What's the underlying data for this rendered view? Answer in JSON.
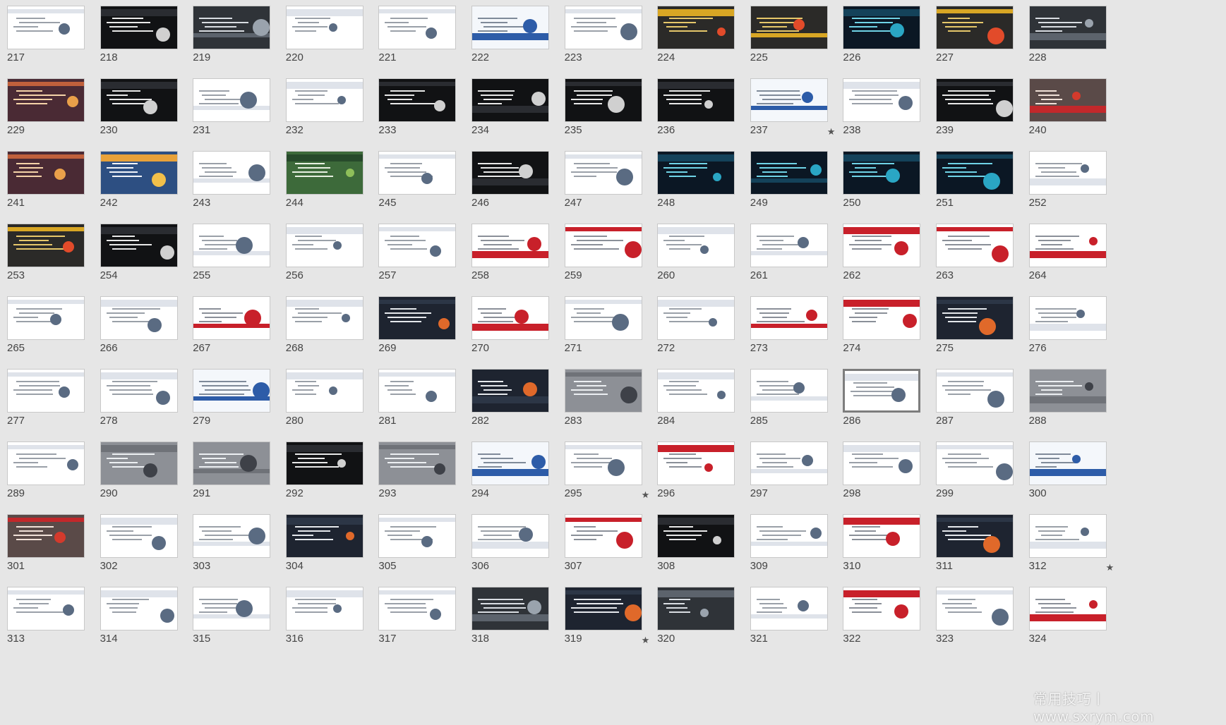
{
  "slides": [
    {
      "number": "217",
      "theme": "light"
    },
    {
      "number": "218",
      "theme": "dark"
    },
    {
      "number": "219",
      "theme": "photo-dark"
    },
    {
      "number": "220",
      "theme": "light"
    },
    {
      "number": "221",
      "theme": "light"
    },
    {
      "number": "222",
      "theme": "light-blue"
    },
    {
      "number": "223",
      "theme": "light"
    },
    {
      "number": "224",
      "theme": "dark-gold"
    },
    {
      "number": "225",
      "theme": "dark-gold"
    },
    {
      "number": "226",
      "theme": "dark-teal"
    },
    {
      "number": "227",
      "theme": "dark-gold"
    },
    {
      "number": "228",
      "theme": "photo-dark"
    },
    {
      "number": "229",
      "theme": "photo-warm"
    },
    {
      "number": "230",
      "theme": "dark"
    },
    {
      "number": "231",
      "theme": "light"
    },
    {
      "number": "232",
      "theme": "light"
    },
    {
      "number": "233",
      "theme": "dark"
    },
    {
      "number": "234",
      "theme": "dark"
    },
    {
      "number": "235",
      "theme": "dark"
    },
    {
      "number": "236",
      "theme": "dark"
    },
    {
      "number": "237",
      "theme": "light-blue",
      "starred": true
    },
    {
      "number": "238",
      "theme": "light"
    },
    {
      "number": "239",
      "theme": "dark"
    },
    {
      "number": "240",
      "theme": "photo-red"
    },
    {
      "number": "241",
      "theme": "photo-warm"
    },
    {
      "number": "242",
      "theme": "photo-blue"
    },
    {
      "number": "243",
      "theme": "light"
    },
    {
      "number": "244",
      "theme": "photo-green"
    },
    {
      "number": "245",
      "theme": "light"
    },
    {
      "number": "246",
      "theme": "dark"
    },
    {
      "number": "247",
      "theme": "light"
    },
    {
      "number": "248",
      "theme": "dark-teal"
    },
    {
      "number": "249",
      "theme": "dark-teal"
    },
    {
      "number": "250",
      "theme": "dark-teal"
    },
    {
      "number": "251",
      "theme": "dark-teal"
    },
    {
      "number": "252",
      "theme": "light"
    },
    {
      "number": "253",
      "theme": "dark-gold"
    },
    {
      "number": "254",
      "theme": "dark"
    },
    {
      "number": "255",
      "theme": "light"
    },
    {
      "number": "256",
      "theme": "light"
    },
    {
      "number": "257",
      "theme": "light"
    },
    {
      "number": "258",
      "theme": "light-red"
    },
    {
      "number": "259",
      "theme": "light-red"
    },
    {
      "number": "260",
      "theme": "light"
    },
    {
      "number": "261",
      "theme": "light"
    },
    {
      "number": "262",
      "theme": "light-red"
    },
    {
      "number": "263",
      "theme": "light-red"
    },
    {
      "number": "264",
      "theme": "light-red"
    },
    {
      "number": "265",
      "theme": "light"
    },
    {
      "number": "266",
      "theme": "light"
    },
    {
      "number": "267",
      "theme": "light-red"
    },
    {
      "number": "268",
      "theme": "light"
    },
    {
      "number": "269",
      "theme": "dark-orange"
    },
    {
      "number": "270",
      "theme": "light-red"
    },
    {
      "number": "271",
      "theme": "light"
    },
    {
      "number": "272",
      "theme": "light"
    },
    {
      "number": "273",
      "theme": "light-red"
    },
    {
      "number": "274",
      "theme": "light-red"
    },
    {
      "number": "275",
      "theme": "dark-orange"
    },
    {
      "number": "276",
      "theme": "light"
    },
    {
      "number": "277",
      "theme": "light"
    },
    {
      "number": "278",
      "theme": "light"
    },
    {
      "number": "279",
      "theme": "light-blue"
    },
    {
      "number": "280",
      "theme": "light"
    },
    {
      "number": "281",
      "theme": "light"
    },
    {
      "number": "282",
      "theme": "dark-orange"
    },
    {
      "number": "283",
      "theme": "gray"
    },
    {
      "number": "284",
      "theme": "light"
    },
    {
      "number": "285",
      "theme": "light"
    },
    {
      "number": "286",
      "theme": "light",
      "selected": true
    },
    {
      "number": "287",
      "theme": "light"
    },
    {
      "number": "288",
      "theme": "gray"
    },
    {
      "number": "289",
      "theme": "light"
    },
    {
      "number": "290",
      "theme": "gray"
    },
    {
      "number": "291",
      "theme": "gray"
    },
    {
      "number": "292",
      "theme": "dark"
    },
    {
      "number": "293",
      "theme": "gray"
    },
    {
      "number": "294",
      "theme": "light-blue"
    },
    {
      "number": "295",
      "theme": "light",
      "starred": true
    },
    {
      "number": "296",
      "theme": "light-red"
    },
    {
      "number": "297",
      "theme": "light"
    },
    {
      "number": "298",
      "theme": "light"
    },
    {
      "number": "299",
      "theme": "light"
    },
    {
      "number": "300",
      "theme": "light-blue"
    },
    {
      "number": "301",
      "theme": "photo-red"
    },
    {
      "number": "302",
      "theme": "light"
    },
    {
      "number": "303",
      "theme": "light"
    },
    {
      "number": "304",
      "theme": "dark-orange"
    },
    {
      "number": "305",
      "theme": "light"
    },
    {
      "number": "306",
      "theme": "light"
    },
    {
      "number": "307",
      "theme": "light-red"
    },
    {
      "number": "308",
      "theme": "dark"
    },
    {
      "number": "309",
      "theme": "light"
    },
    {
      "number": "310",
      "theme": "light-red"
    },
    {
      "number": "311",
      "theme": "dark-orange"
    },
    {
      "number": "312",
      "theme": "light",
      "starred": true
    },
    {
      "number": "313",
      "theme": "light"
    },
    {
      "number": "314",
      "theme": "light"
    },
    {
      "number": "315",
      "theme": "light"
    },
    {
      "number": "316",
      "theme": "light"
    },
    {
      "number": "317",
      "theme": "light"
    },
    {
      "number": "318",
      "theme": "photo-dark"
    },
    {
      "number": "319",
      "theme": "dark-orange",
      "starred": true
    },
    {
      "number": "320",
      "theme": "photo-dark"
    },
    {
      "number": "321",
      "theme": "light"
    },
    {
      "number": "322",
      "theme": "light-red"
    },
    {
      "number": "323",
      "theme": "light"
    },
    {
      "number": "324",
      "theme": "light-red"
    }
  ],
  "star_glyph": "★",
  "watermark": "常用技巧丨www.sxrym.com"
}
